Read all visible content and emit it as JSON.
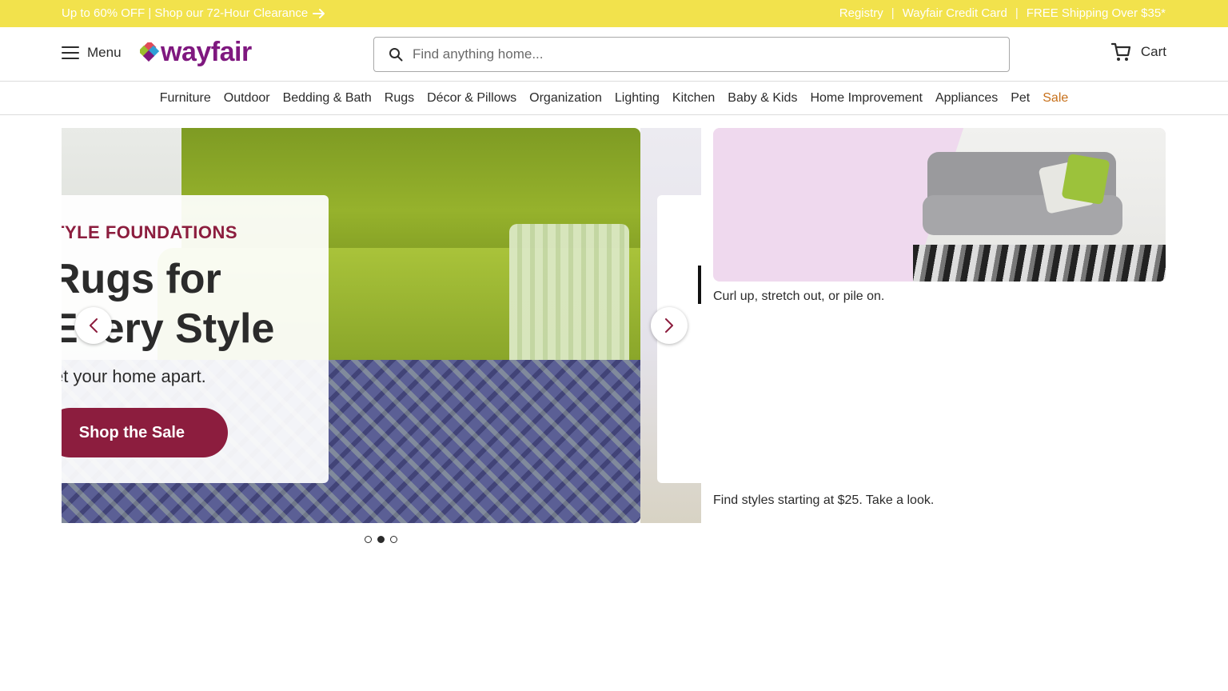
{
  "promo": {
    "left_text": "Up to 60% OFF | Shop our 72-Hour Clearance",
    "links": [
      "Registry",
      "Wayfair Credit Card",
      "FREE Shipping Over $35*"
    ],
    "separator": "|"
  },
  "header": {
    "menu_label": "Menu",
    "logo_text": "wayfair",
    "search_placeholder": "Find anything home...",
    "cart_label": "Cart"
  },
  "categories": [
    "Furniture",
    "Outdoor",
    "Bedding & Bath",
    "Rugs",
    "Décor & Pillows",
    "Organization",
    "Lighting",
    "Kitchen",
    "Baby & Kids",
    "Home Improvement",
    "Appliances",
    "Pet",
    "Sale"
  ],
  "carousel": {
    "eyebrow": "TYLE FOUNDATIONS",
    "title": "Rugs for Every Style",
    "subtitle": "et your home apart.",
    "cta": "Shop the Sale",
    "dots": 3,
    "active_dot": 1
  },
  "right_panel": {
    "caption": "Curl up, stretch out, or pile on.",
    "caption2": "Find styles starting at $25. Take a look."
  },
  "colors": {
    "promo_bg": "#f2e24c",
    "brand": "#7f187f",
    "accent": "#8c1d3e",
    "sale": "#c7701a"
  }
}
